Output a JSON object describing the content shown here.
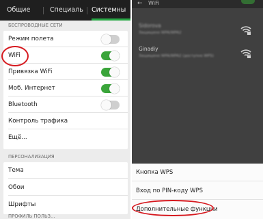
{
  "left": {
    "tabs": [
      "Общие",
      "Специаль",
      "Системны"
    ],
    "sections": {
      "wireless": "БЕСПРОВОДНЫЕ СЕТИ",
      "personalization": "ПЕРСОНАЛИЗАЦИЯ",
      "bottom_partial": "ПРОФИЛЬ ПОЛЬЗ..."
    },
    "wireless_rows": [
      {
        "label": "Режим полета",
        "toggle": "off"
      },
      {
        "label": "WiFi",
        "toggle": "on"
      },
      {
        "label": "Привязка WiFi",
        "toggle": "on"
      },
      {
        "label": "Моб. Интернет",
        "toggle": "on"
      },
      {
        "label": "Bluetooth",
        "toggle": "off"
      },
      {
        "label": "Контроль трафика"
      },
      {
        "label": "Ещё..."
      }
    ],
    "personalization_rows": [
      {
        "label": "Тема"
      },
      {
        "label": "Обои"
      },
      {
        "label": "Шрифты"
      }
    ]
  },
  "right": {
    "header": {
      "back": "←",
      "title": "WiFi"
    },
    "networks": [
      {
        "name": "Sidorova",
        "sub": "Защищено WPA/WPA2"
      },
      {
        "name": "Ginadiy",
        "sub": "Защищено WPA/WPA2 (доступно WPS)"
      }
    ],
    "menu": [
      "Кнопка WPS",
      "Вход по PIN-коду WPS",
      "Дополнительные функции"
    ]
  },
  "colors": {
    "accent_green": "#3aa53a",
    "highlight_red": "#d6191f"
  }
}
